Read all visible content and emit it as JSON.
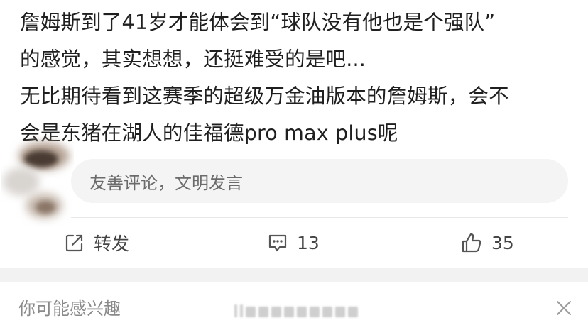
{
  "post": {
    "lines": [
      "詹姆斯到了41岁才能体会到“球队没有他也是个强队”",
      "的感觉，其实想想，还挺难受的是吧...",
      "无比期待看到这赛季的超级万金油版本的詹姆斯，会不",
      "会是东猪在湖人的佳福德pro max plus呢"
    ]
  },
  "comment": {
    "placeholder": "友善评论，文明发言"
  },
  "actions": {
    "repost_label": "转发",
    "comment_count": "13",
    "like_count": "35"
  },
  "recommend": {
    "title": "你可能感兴趣"
  },
  "icons": {
    "repost": "edit-share-icon",
    "comment": "comment-bubble-icon",
    "like": "thumbs-up-icon",
    "close": "close-icon"
  },
  "colors": {
    "text": "#1f1f1f",
    "muted": "#8a8a8a",
    "comment_bg": "#f4f4f4",
    "band": "#f2f2f2"
  }
}
